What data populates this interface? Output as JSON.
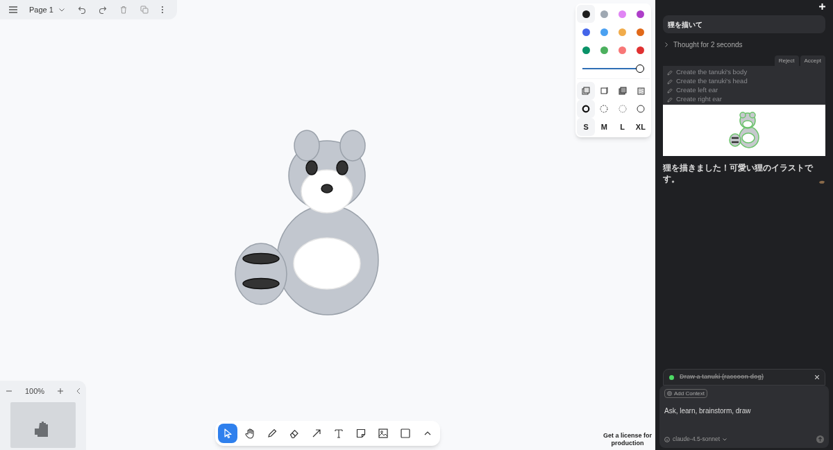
{
  "top_bar": {
    "page": "Page 1"
  },
  "style_panel": {
    "colors": [
      {
        "color": "#1d1d1d",
        "selected": true
      },
      {
        "color": "#9fa8b2",
        "selected": false
      },
      {
        "color": "#e085f4",
        "selected": false
      },
      {
        "color": "#ae3ec9",
        "selected": false
      },
      {
        "color": "#4465e9",
        "selected": false
      },
      {
        "color": "#4ba1f1",
        "selected": false
      },
      {
        "color": "#f1ac4b",
        "selected": false
      },
      {
        "color": "#e16919",
        "selected": false
      },
      {
        "color": "#099268",
        "selected": false
      },
      {
        "color": "#4cb05e",
        "selected": false
      },
      {
        "color": "#f87777",
        "selected": false
      },
      {
        "color": "#e03131",
        "selected": false
      }
    ],
    "opacity": {
      "level": 1
    },
    "fills": [
      {
        "kind": "none",
        "selected": true
      },
      {
        "kind": "semi",
        "selected": false
      },
      {
        "kind": "solid",
        "selected": false
      },
      {
        "kind": "pattern",
        "selected": false
      }
    ],
    "dashes": [
      {
        "kind": "draw",
        "selected": true
      },
      {
        "kind": "dashed",
        "selected": false
      },
      {
        "kind": "dotted",
        "selected": false
      },
      {
        "kind": "solid",
        "selected": false
      }
    ],
    "sizes": [
      {
        "label": "S",
        "selected": true
      },
      {
        "label": "M",
        "selected": false
      },
      {
        "label": "L",
        "selected": false
      },
      {
        "label": "XL",
        "selected": false
      }
    ]
  },
  "zoom": {
    "value": "100%"
  },
  "tools": [
    {
      "kind": "select",
      "selected": true
    },
    {
      "kind": "hand",
      "selected": false
    },
    {
      "kind": "draw",
      "selected": false
    },
    {
      "kind": "eraser",
      "selected": false
    },
    {
      "kind": "arrow",
      "selected": false
    },
    {
      "kind": "text",
      "selected": false
    },
    {
      "kind": "note",
      "selected": false
    },
    {
      "kind": "image",
      "selected": false
    },
    {
      "kind": "rectangle",
      "selected": false
    },
    {
      "kind": "more",
      "selected": false
    }
  ],
  "license": "Get a license for production",
  "chat": {
    "user_message": "狸を描いて",
    "thought": "Thought for 2 seconds",
    "actions": [
      "Reject",
      "Accept"
    ],
    "steps": [
      "Create the tanuki's body",
      "Create the tanuki's head",
      "Create left ear",
      "Create right ear"
    ],
    "reply": "狸を描きました！可愛い狸のイラストです。",
    "task": {
      "text": "Draw a tanuki (raccoon dog)",
      "done": true
    },
    "add_context": "Add Context",
    "placeholder": "Ask, learn, brainstorm, draw",
    "model": "claude-4.5-sonnet"
  }
}
